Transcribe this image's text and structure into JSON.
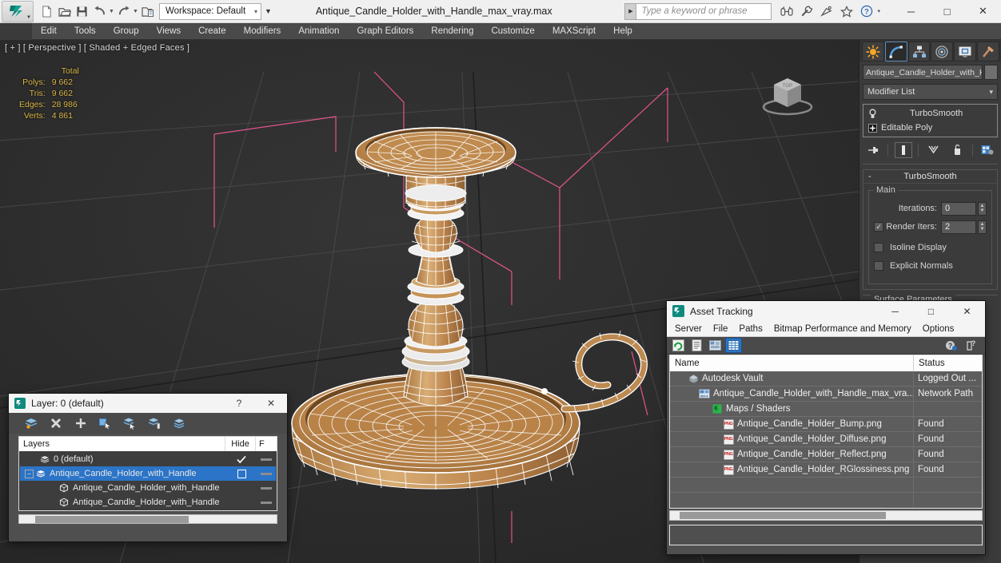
{
  "titlebar": {
    "workspace": "Workspace: Default",
    "document_title": "Antique_Candle_Holder_with_Handle_max_vray.max",
    "search_placeholder": "Type a keyword or phrase",
    "quick_access": [
      "new-file-icon",
      "open-file-icon",
      "save-file-icon",
      "undo-icon",
      "redo-icon",
      "set-project-folder-icon"
    ],
    "title_icons": [
      "binoculars-icon",
      "wrench-icon",
      "satellite-icon",
      "star-icon",
      "help-icon"
    ],
    "window_controls": {
      "minimize": "─",
      "maximize": "□",
      "close": "✕"
    }
  },
  "menubar": {
    "items": [
      "Edit",
      "Tools",
      "Group",
      "Views",
      "Create",
      "Modifiers",
      "Animation",
      "Graph Editors",
      "Rendering",
      "Customize",
      "MAXScript",
      "Help"
    ]
  },
  "viewport": {
    "label": "[ + ] [ Perspective ] [ Shaded + Edged Faces ]",
    "stats": {
      "header": "Total",
      "rows": [
        {
          "label": "Polys:",
          "value": "9 662"
        },
        {
          "label": "Tris:",
          "value": "9 662"
        },
        {
          "label": "Edges:",
          "value": "28 986"
        },
        {
          "label": "Verts:",
          "value": "4 861"
        }
      ]
    },
    "stats_color": "#d8b447",
    "background_color": "#2e2e2e",
    "model_wire_color": "#ffffff",
    "model_fill_color": "#c69356",
    "helper_color": "#e0568c",
    "viewcube_label": "TOP"
  },
  "command_panel": {
    "tabs": [
      "create-tab",
      "modify-tab",
      "hierarchy-tab",
      "motion-tab",
      "display-tab",
      "utilities-tab"
    ],
    "active_tab": "modify-tab",
    "object_name": "Antique_Candle_Holder_with_H",
    "modifier_list_label": "Modifier List",
    "stack": [
      {
        "label": "TurboSmooth",
        "icon": "lightbulb-icon"
      },
      {
        "label": "Editable Poly",
        "icon": "plus-box-icon"
      }
    ],
    "stack_buttons": [
      "pin-stack-icon",
      "show-end-result-icon",
      "make-unique-icon",
      "remove-modifier-icon",
      "configure-modifier-sets-icon"
    ],
    "rollout": {
      "title": "TurboSmooth",
      "collapse_glyph": "-",
      "group_label": "Main",
      "iterations_label": "Iterations:",
      "iterations_value": "0",
      "render_iters_label": "Render Iters:",
      "render_iters_value": "2",
      "render_iters_checked": true,
      "isoline_display_label": "Isoline Display",
      "isoline_display_checked": false,
      "explicit_normals_label": "Explicit Normals",
      "explicit_normals_checked": false
    },
    "next_rollout_label": "Surface Parameters"
  },
  "asset_tracking": {
    "title": "Asset Tracking",
    "window_controls": {
      "minimize": "─",
      "maximize": "□",
      "close": "✕"
    },
    "menu": [
      "Server",
      "File",
      "Paths",
      "Bitmap Performance and Memory",
      "Options"
    ],
    "toolbar": [
      "refresh-icon",
      "list-view-icon",
      "detail-view-icon",
      "grid-view-icon"
    ],
    "toolbar_right": [
      "help-new-icon",
      "help-question-icon"
    ],
    "active_toolbar_button": "grid-view-icon",
    "columns": [
      "Name",
      "Status"
    ],
    "rows": [
      {
        "name": "Autodesk Vault",
        "status": "Logged Out ...",
        "icon": "vault-icon",
        "indent": 1
      },
      {
        "name": "Antique_Candle_Holder_with_Handle_max_vra...",
        "status": "Network Path",
        "icon": "max-file-icon",
        "indent": 2
      },
      {
        "name": "Maps / Shaders",
        "status": "",
        "icon": "maps-shaders-icon",
        "indent": 3
      },
      {
        "name": "Antique_Candle_Holder_Bump.png",
        "status": "Found",
        "icon": "png-icon",
        "indent": 4
      },
      {
        "name": "Antique_Candle_Holder_Diffuse.png",
        "status": "Found",
        "icon": "png-icon",
        "indent": 4
      },
      {
        "name": "Antique_Candle_Holder_Reflect.png",
        "status": "Found",
        "icon": "png-icon",
        "indent": 4
      },
      {
        "name": "Antique_Candle_Holder_RGlossiness.png",
        "status": "Found",
        "icon": "png-icon",
        "indent": 4
      }
    ]
  },
  "layer_dialog": {
    "title": "Layer: 0 (default)",
    "help_glyph": "?",
    "close_glyph": "✕",
    "toolbar": [
      "new-layer-icon",
      "delete-layer-icon",
      "add-layer-icon",
      "select-objects-in-layer-icon",
      "select-highlighted-objects-icon",
      "highlight-selected-objects-icon",
      "add-selection-to-layer-icon"
    ],
    "columns": {
      "layers": "Layers",
      "hide": "Hide",
      "freeze": "F"
    },
    "rows": [
      {
        "name": "0 (default)",
        "icon": "layer-icon",
        "hide": "check",
        "freeze": "dash",
        "selected": false,
        "indent": 1,
        "expander": false
      },
      {
        "name": "Antique_Candle_Holder_with_Handle",
        "icon": "layer-icon",
        "hide": "box",
        "freeze": "dash",
        "selected": true,
        "indent": 0,
        "expander": true
      },
      {
        "name": "Antique_Candle_Holder_with_Handle",
        "icon": "object-icon",
        "hide": "none",
        "freeze": "dash",
        "selected": false,
        "indent": 2,
        "expander": false
      },
      {
        "name": "Antique_Candle_Holder_with_Handle",
        "icon": "object-icon",
        "hide": "none",
        "freeze": "dash",
        "selected": false,
        "indent": 2,
        "expander": false
      }
    ]
  },
  "colors": {
    "accent_blue": "#2b74c7",
    "panel_gray": "#3b3b3b",
    "dialog_gray": "#4f4f4f",
    "viewport_bg": "#2e2e2e"
  }
}
